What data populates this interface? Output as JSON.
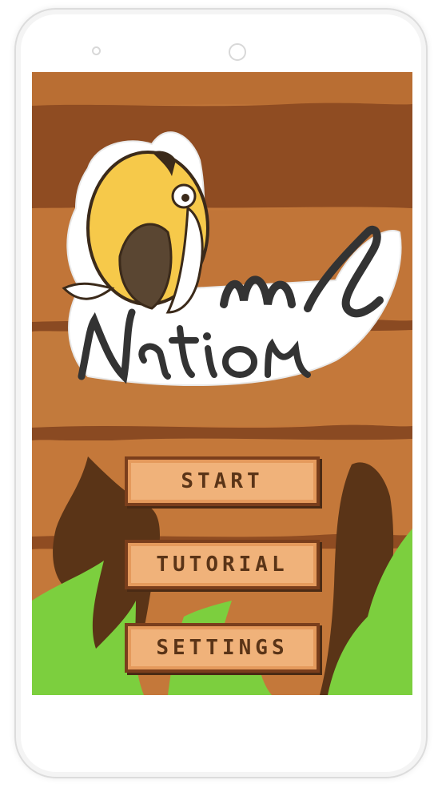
{
  "game": {
    "logo_line1": "wl",
    "logo_line2": "Nation",
    "logo_alt": "Owl Nation"
  },
  "menu": {
    "start_label": "START",
    "tutorial_label": "TUTORIAL",
    "settings_label": "SETTINGS"
  },
  "colors": {
    "wood_light": "#c4783a",
    "wood_dark": "#8f4c22",
    "button_fill": "#f0b27a",
    "button_border": "#7a3e1c",
    "grass": "#7ccf3e",
    "owl_yellow": "#f6c94a"
  }
}
